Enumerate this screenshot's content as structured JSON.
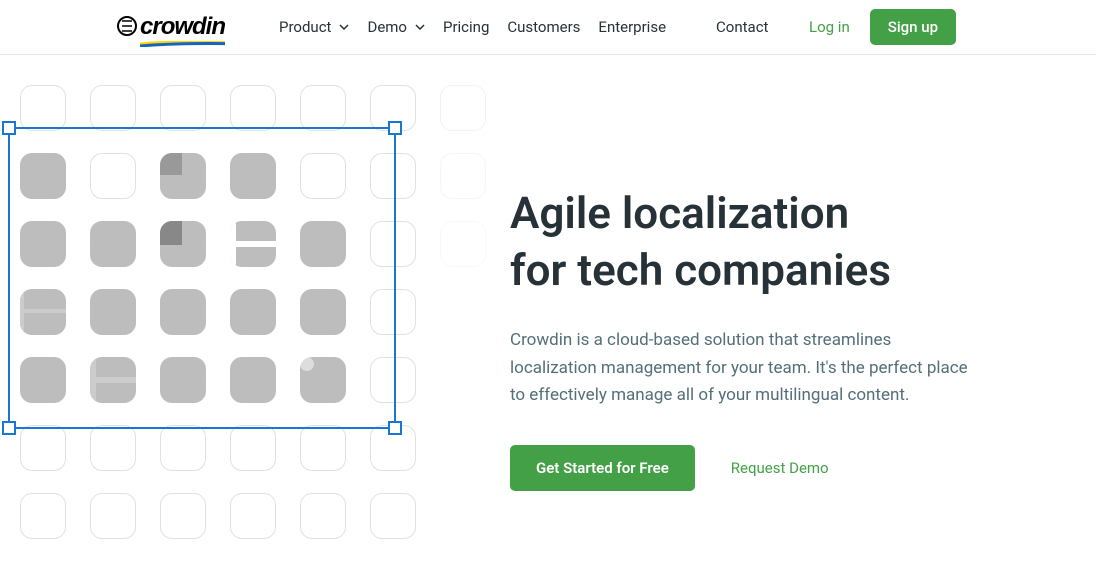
{
  "header": {
    "logo_text": "crowdin",
    "nav": {
      "product": "Product",
      "demo": "Demo",
      "pricing": "Pricing",
      "customers": "Customers",
      "enterprise": "Enterprise",
      "contact": "Contact"
    },
    "login": "Log in",
    "signup": "Sign up"
  },
  "hero": {
    "title_line1": "Agile localization",
    "title_line2": "for tech companies",
    "description": "Crowdin is a cloud-based solution that streamlines localization management for your team. It's the perfect place to effectively manage all of your multilingual content.",
    "cta_primary": "Get Started for Free",
    "cta_link": "Request Demo"
  },
  "colors": {
    "primary_green": "#43a047",
    "selection_blue": "#1976d2"
  }
}
